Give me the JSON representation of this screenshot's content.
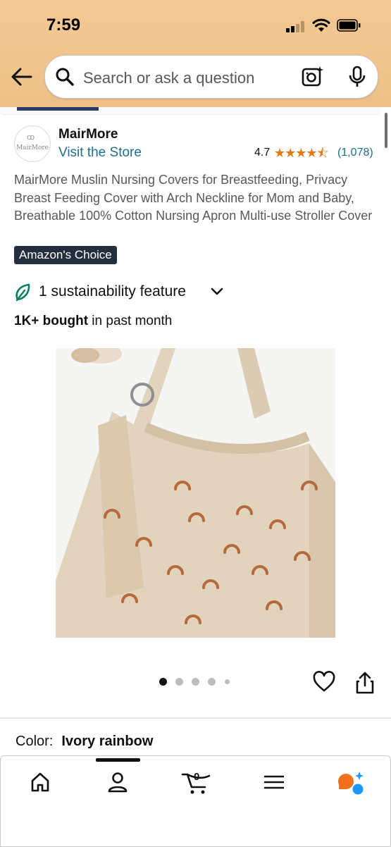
{
  "status_bar": {
    "time": "7:59"
  },
  "search": {
    "placeholder": "Search or ask a question"
  },
  "icons": {
    "back": "arrow-left-icon",
    "search": "magnifier-icon",
    "camera": "camera-lens-icon",
    "mic": "microphone-icon",
    "leaf": "leaf-icon",
    "wishlist": "heart-icon",
    "share": "share-icon",
    "home": "home-icon",
    "account": "person-icon",
    "cart": "cart-icon",
    "menu": "hamburger-icon",
    "assistant": "assistant-icon"
  },
  "brand": {
    "name": "MairMore",
    "logo_text": "MairMore",
    "store_link": "Visit the Store"
  },
  "rating": {
    "value": "4.7",
    "stars": 4.7,
    "stars_text": "★★★★⯪",
    "count": "(1,078)"
  },
  "product": {
    "title": "MairMore Muslin Nursing Covers for Breastfeeding, Privacy Breast Feeding Cover with Arch Neckline for Mom and Baby, Breathable 100% Cotton Nursing Apron Multi-use Stroller Cover",
    "badge": "Amazon's Choice",
    "sustainability": "1 sustainability feature",
    "bought_bold": "1K+ bought",
    "bought_rest": " in past month",
    "image_count": 5,
    "active_image": 1
  },
  "variant": {
    "label": "Color:",
    "value": "Ivory rainbow"
  },
  "bottom_nav": {
    "cart_count": "0"
  },
  "colors": {
    "header_bg": "#f0c48d",
    "link": "#1f6f8b",
    "star": "#e47911",
    "badge_bg": "#232f3e",
    "leaf": "#067d62",
    "fabric": "#e2d3bd",
    "arch_print": "#b66a3c"
  }
}
